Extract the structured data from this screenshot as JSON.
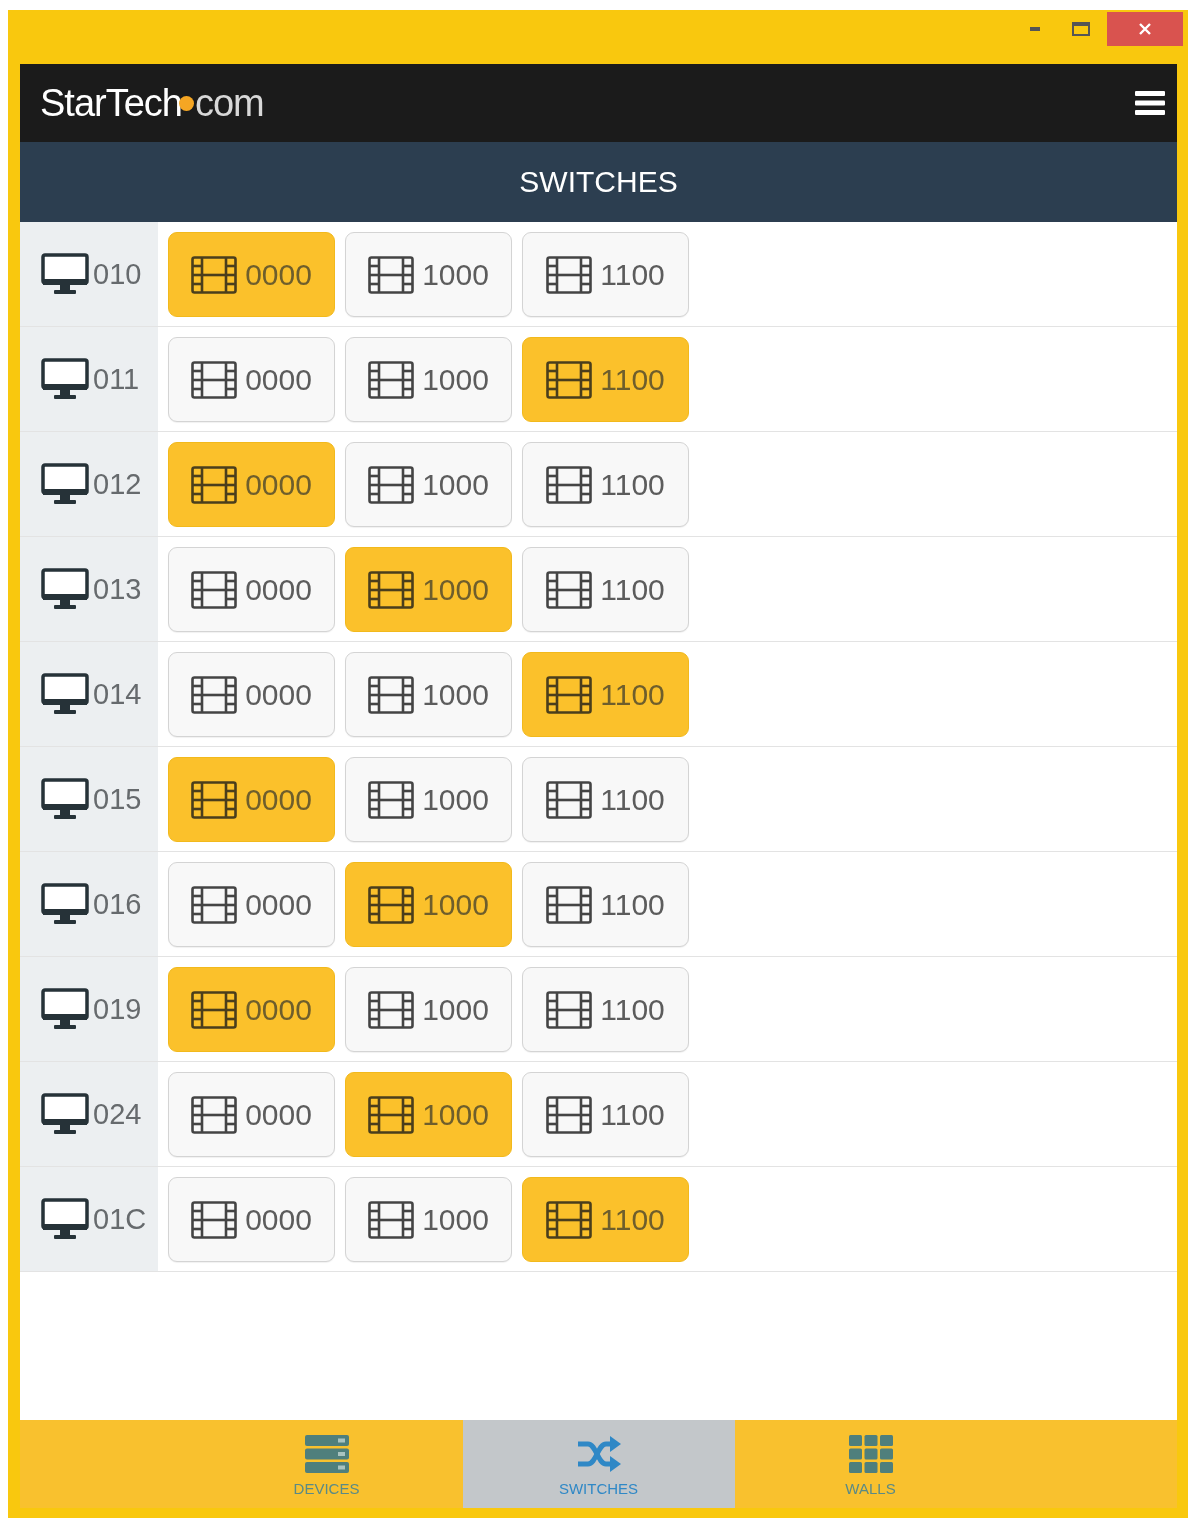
{
  "header": {
    "logo": {
      "name": "StarTech",
      "domain": "com"
    }
  },
  "page_title": "SWITCHES",
  "switches": [
    {
      "display": "010",
      "sources": [
        {
          "label": "0000",
          "selected": true
        },
        {
          "label": "1000",
          "selected": false
        },
        {
          "label": "1100",
          "selected": false
        }
      ]
    },
    {
      "display": "011",
      "sources": [
        {
          "label": "0000",
          "selected": false
        },
        {
          "label": "1000",
          "selected": false
        },
        {
          "label": "1100",
          "selected": true
        }
      ]
    },
    {
      "display": "012",
      "sources": [
        {
          "label": "0000",
          "selected": true
        },
        {
          "label": "1000",
          "selected": false
        },
        {
          "label": "1100",
          "selected": false
        }
      ]
    },
    {
      "display": "013",
      "sources": [
        {
          "label": "0000",
          "selected": false
        },
        {
          "label": "1000",
          "selected": true
        },
        {
          "label": "1100",
          "selected": false
        }
      ]
    },
    {
      "display": "014",
      "sources": [
        {
          "label": "0000",
          "selected": false
        },
        {
          "label": "1000",
          "selected": false
        },
        {
          "label": "1100",
          "selected": true
        }
      ]
    },
    {
      "display": "015",
      "sources": [
        {
          "label": "0000",
          "selected": true
        },
        {
          "label": "1000",
          "selected": false
        },
        {
          "label": "1100",
          "selected": false
        }
      ]
    },
    {
      "display": "016",
      "sources": [
        {
          "label": "0000",
          "selected": false
        },
        {
          "label": "1000",
          "selected": true
        },
        {
          "label": "1100",
          "selected": false
        }
      ]
    },
    {
      "display": "019",
      "sources": [
        {
          "label": "0000",
          "selected": true
        },
        {
          "label": "1000",
          "selected": false
        },
        {
          "label": "1100",
          "selected": false
        }
      ]
    },
    {
      "display": "024",
      "sources": [
        {
          "label": "0000",
          "selected": false
        },
        {
          "label": "1000",
          "selected": true
        },
        {
          "label": "1100",
          "selected": false
        }
      ]
    },
    {
      "display": "01C",
      "sources": [
        {
          "label": "0000",
          "selected": false
        },
        {
          "label": "1000",
          "selected": false
        },
        {
          "label": "1100",
          "selected": true
        }
      ]
    }
  ],
  "nav": [
    {
      "label": "DEVICES",
      "selected": false
    },
    {
      "label": "SWITCHES",
      "selected": true
    },
    {
      "label": "WALLS",
      "selected": false
    }
  ]
}
